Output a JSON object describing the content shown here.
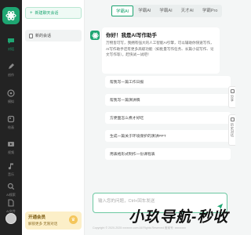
{
  "rail": {
    "items": [
      {
        "label": "对话",
        "icon": "chat-icon"
      },
      {
        "label": "创作",
        "icon": "pen-icon"
      },
      {
        "label": "模拟",
        "icon": "compass-icon"
      },
      {
        "label": "绘画",
        "icon": "palette-icon"
      },
      {
        "label": "视频",
        "icon": "video-icon"
      },
      {
        "label": "音乐",
        "icon": "music-icon"
      },
      {
        "label": "AI搜索",
        "icon": "search-icon"
      },
      {
        "label": "AI文件",
        "icon": "file-icon"
      }
    ]
  },
  "history": {
    "new_chat_label": "新建聊天会话",
    "items": [
      "新的会话"
    ],
    "vip": {
      "title": "开通会员",
      "subtitle": "解锁更多 无限对话"
    }
  },
  "tabs": {
    "items": [
      "学霸AI",
      "学霸AI",
      "学霸AI",
      "天才AI",
      "学霸Pro"
    ],
    "active_index": 0
  },
  "welcome": {
    "title": "你好！我是AI写作助手",
    "body": "万物皆可写，我拥有强大的人工智能AI引擎，可以辅助你快速写作，AI写作助手还有更多高级功能（如批量写作任务、长篇小说写作、论文写作等），赶快试一试吧！"
  },
  "suggestions": [
    "帮我写一篇工作日报",
    "帮我写一篇演讲稿",
    "方便面怎么煮才好吃",
    "生成一篇关于环境保护的演讲PPT",
    "用表格形式制作一份课程表"
  ],
  "side_tools": [
    {
      "label": "分享",
      "icon": "share-icon"
    },
    {
      "label": "历史对话",
      "icon": "history-icon"
    }
  ],
  "input": {
    "placeholder": "输入您的问题，Ctrl+回车发送"
  },
  "footer": "Copyright © 2020-2025 xxxxxxx.com All Rights Reserved 备案号: xxxxxxxx",
  "watermark": "小玖导航-秒收",
  "colors": {
    "accent": "#1ea672",
    "rail_bg": "#232323",
    "vip_bg": "#fcefc8"
  }
}
